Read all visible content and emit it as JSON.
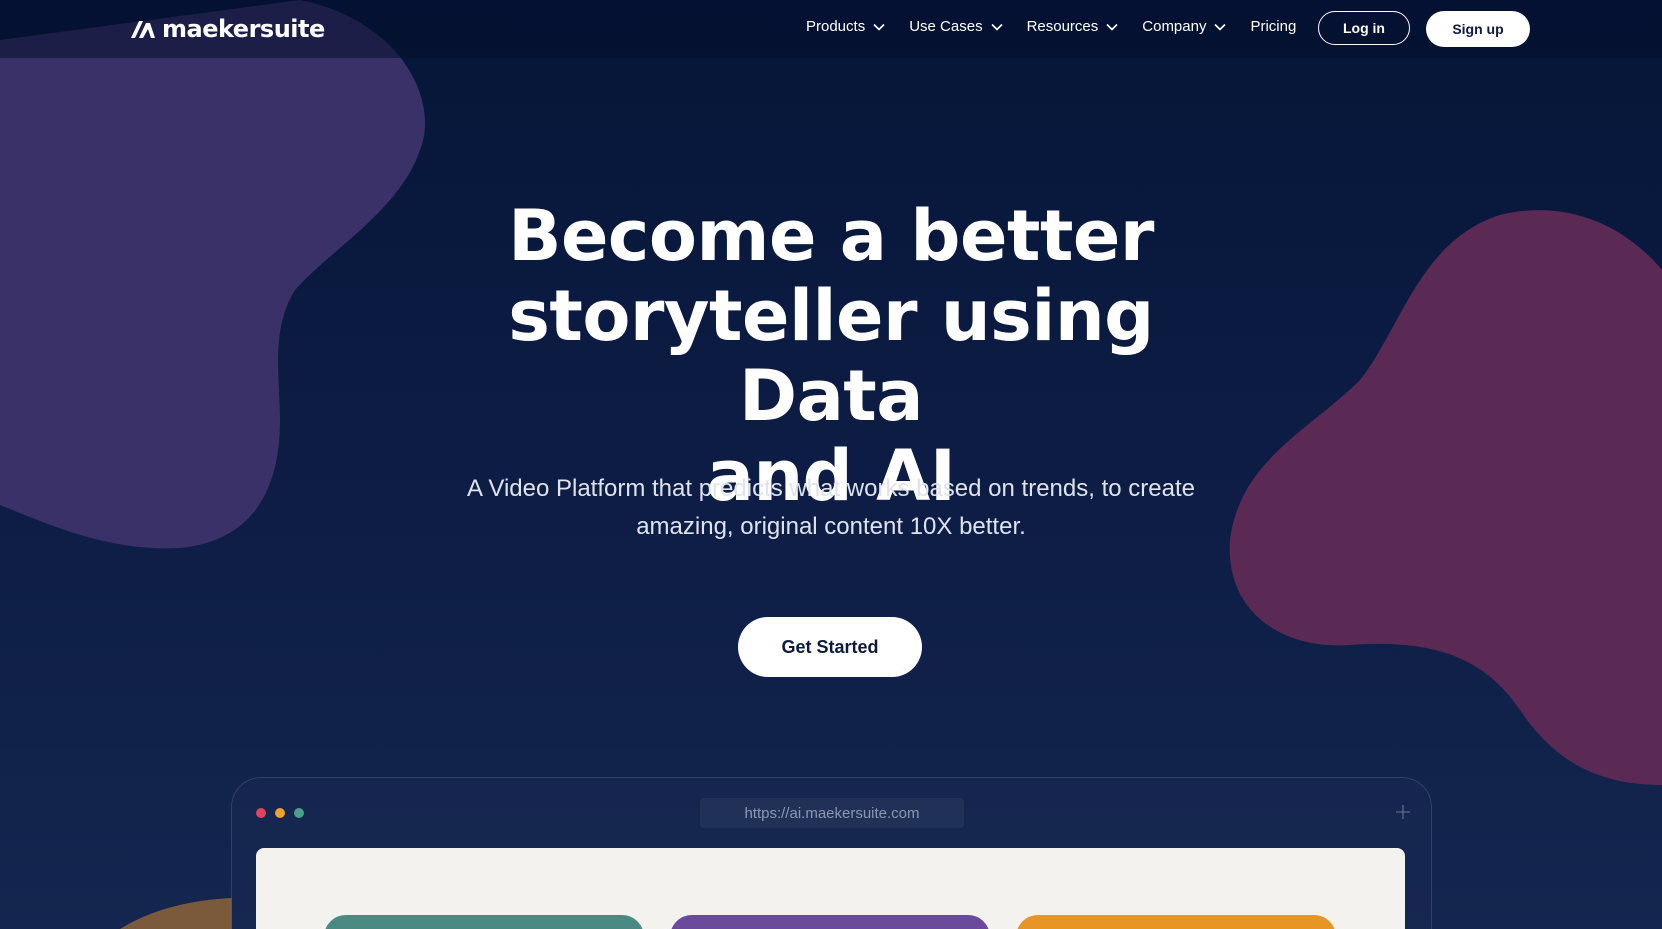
{
  "brand": {
    "name": "maekersuite"
  },
  "nav": {
    "items": [
      {
        "label": "Products",
        "has_dropdown": true
      },
      {
        "label": "Use Cases",
        "has_dropdown": true
      },
      {
        "label": "Resources",
        "has_dropdown": true
      },
      {
        "label": "Company",
        "has_dropdown": true
      },
      {
        "label": "Pricing",
        "has_dropdown": false
      }
    ],
    "login_label": "Log in",
    "signup_label": "Sign up"
  },
  "hero": {
    "title_line1": "Become a better",
    "title_line2": "storyteller using Data",
    "title_line3": "and AI",
    "subtitle_line1": "A Video Platform that predicts what works based on trends, to create",
    "subtitle_line2": "amazing, original content 10X better.",
    "cta_label": "Get Started"
  },
  "browser_mock": {
    "url": "https://ai.maekersuite.com",
    "cards": [
      {
        "color": "#4a8a83"
      },
      {
        "color": "#6a4a9a"
      },
      {
        "color": "#e79524"
      }
    ]
  },
  "colors": {
    "background": "#0b1a3d",
    "blob_left": "#3a3169",
    "blob_right": "#5a2a55",
    "dot_red": "#e0455e",
    "dot_yellow": "#eea12e",
    "dot_green": "#4aa08a"
  }
}
